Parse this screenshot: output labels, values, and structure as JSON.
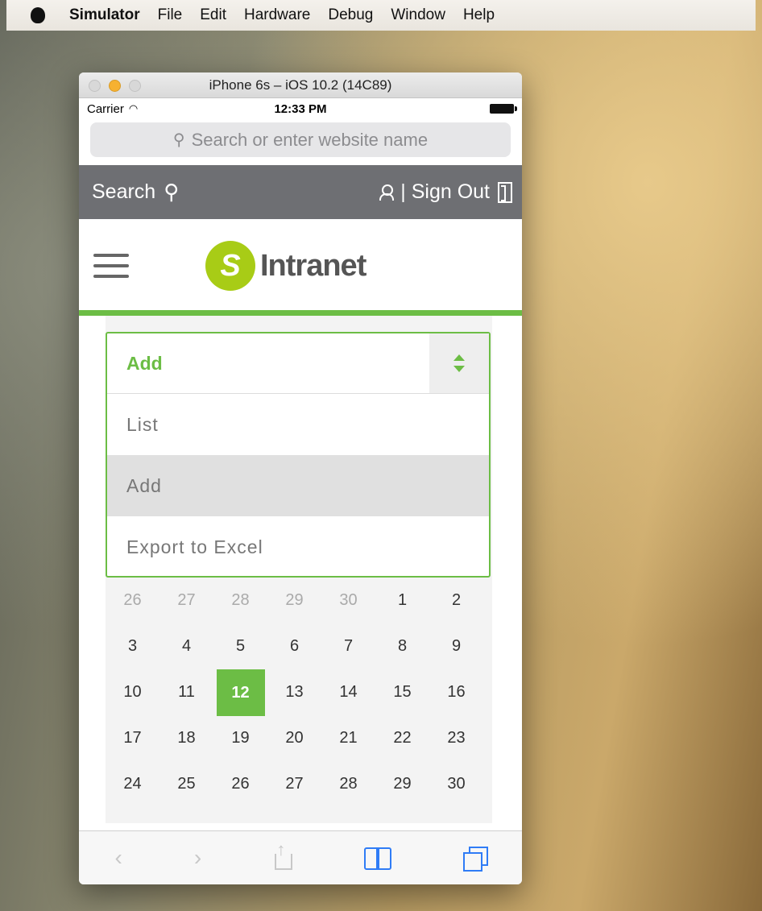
{
  "menubar": {
    "app": "Simulator",
    "items": [
      "File",
      "Edit",
      "Hardware",
      "Debug",
      "Window",
      "Help"
    ]
  },
  "window": {
    "title": "iPhone 6s – iOS 10.2 (14C89)"
  },
  "statusbar": {
    "carrier": "Carrier",
    "time": "12:33 PM"
  },
  "safari": {
    "url_placeholder": "Search or enter website name"
  },
  "site": {
    "search_label": "Search",
    "signout_label": "| Sign Out",
    "logo_letter": "S",
    "logo_text": "Intranet",
    "accent": "#6cbd45"
  },
  "dropdown": {
    "selected": "Add",
    "options": [
      "List",
      "Add",
      "Export to Excel"
    ],
    "highlighted_index": 1
  },
  "calendar": {
    "rows": [
      [
        "26",
        "27",
        "28",
        "29",
        "30",
        "1",
        "2"
      ],
      [
        "3",
        "4",
        "5",
        "6",
        "7",
        "8",
        "9"
      ],
      [
        "10",
        "11",
        "12",
        "13",
        "14",
        "15",
        "16"
      ],
      [
        "17",
        "18",
        "19",
        "20",
        "21",
        "22",
        "23"
      ],
      [
        "24",
        "25",
        "26",
        "27",
        "28",
        "29",
        "30"
      ]
    ],
    "selected_day": "12"
  },
  "toolbar": {
    "back_icon": "chevron-left-icon",
    "forward_icon": "chevron-right-icon",
    "share_icon": "share-icon",
    "bookmarks_icon": "bookmarks-icon",
    "tabs_icon": "tabs-icon"
  }
}
